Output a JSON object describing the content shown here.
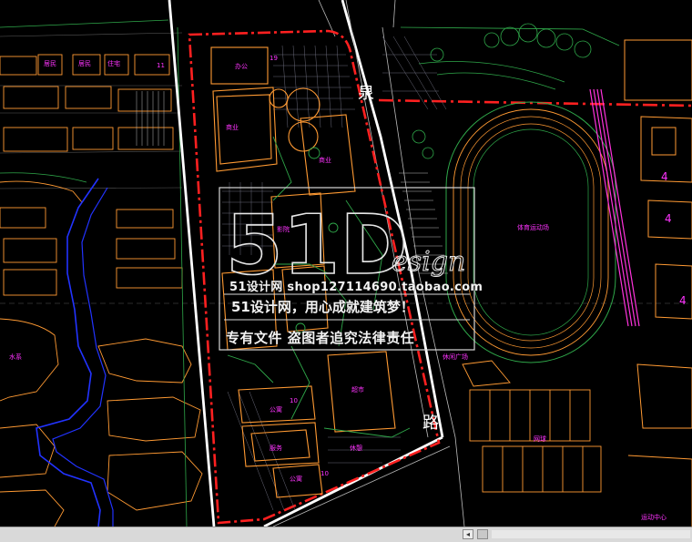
{
  "labels": {
    "office": "办公",
    "office_floors": "19",
    "commerce_a": "商业",
    "commerce_b": "商业",
    "cinema": "影院",
    "hotel": "公寓",
    "hotel_floors": "10",
    "service": "服务",
    "apartment": "公寓",
    "apartment_floors": "10",
    "supermarket": "超市",
    "sports_field": "体育运动场",
    "road_char_quan": "泉",
    "road_char_lu": "路",
    "sun_label": "休憩",
    "tennis": "网球",
    "courts_label": "运动中心",
    "res_a": "居民",
    "res_b": "居民",
    "res_c": "住宅",
    "res_d": "11",
    "bld_num_4a": "4",
    "bld_num_4b": "4",
    "bld_num_4c": "4",
    "plaza": "休闲广场",
    "left_label": "水系"
  },
  "watermark": {
    "logo_main": "51D",
    "logo_sub": "esign",
    "site": "51设计网 shop127114690.taobao.com",
    "slogan": "51设计网，用心成就建筑梦！",
    "warning": "专有文件    盗图者追究法律责任"
  },
  "scrollbar": {
    "left_arrow": "◂"
  },
  "colors": {
    "background": "#000000",
    "site_boundary": "#ff2020",
    "road": "#ffffff",
    "building": "#ff9a33",
    "green": "#2fa84a",
    "text": "#ff00ff",
    "water": "#2233ff",
    "grid": "#7a7a7a"
  }
}
